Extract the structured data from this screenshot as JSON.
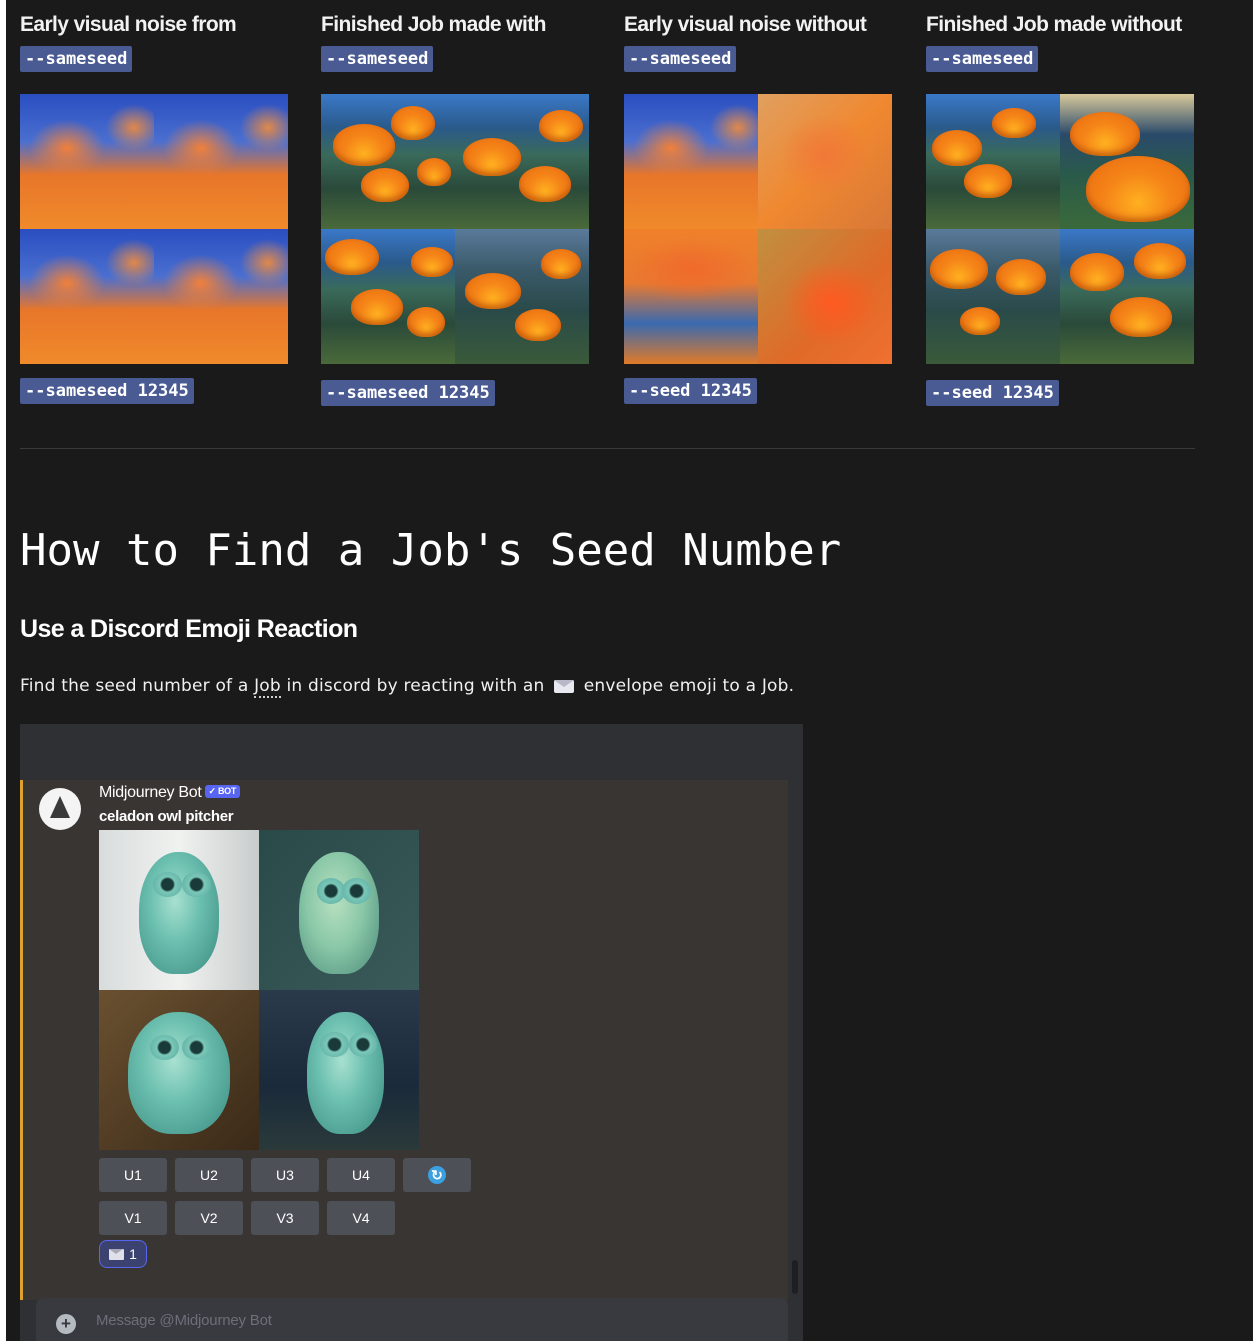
{
  "columns": [
    {
      "title": "Early visual noise from",
      "flag": "--sameseed",
      "caption": "--sameseed 12345"
    },
    {
      "title": "Finished Job made with",
      "flag": "--sameseed",
      "caption": "--sameseed 12345"
    },
    {
      "title": "Early visual noise without",
      "flag": "--sameseed",
      "caption": "--seed 12345"
    },
    {
      "title": "Finished Job made without",
      "flag": "--sameseed",
      "caption": "--seed 12345"
    }
  ],
  "heading": "How to Find a Job's Seed Number",
  "subheading": "Use a Discord Emoji Reaction",
  "paragraph": {
    "before_link": "Find the seed number of a ",
    "link": "Job",
    "middle": " in discord by reacting with an ",
    "after_emoji": " envelope emoji to a Job."
  },
  "discord": {
    "bot_name": "Midjourney Bot",
    "bot_tag": "✓ BOT",
    "prompt": "celadon owl pitcher",
    "upscale_buttons": [
      "U1",
      "U2",
      "U3",
      "U4"
    ],
    "variation_buttons": [
      "V1",
      "V2",
      "V3",
      "V4"
    ],
    "reroll_icon": "refresh-icon",
    "reaction_count": "1",
    "reaction_icon": "envelope-icon",
    "message_placeholder": "Message @Midjourney Bot"
  },
  "colors": {
    "page_bg": "#1a1a1a",
    "code_chip": "#4a5a93",
    "embed_accent": "#e0a030",
    "blurple": "#5865f2"
  }
}
